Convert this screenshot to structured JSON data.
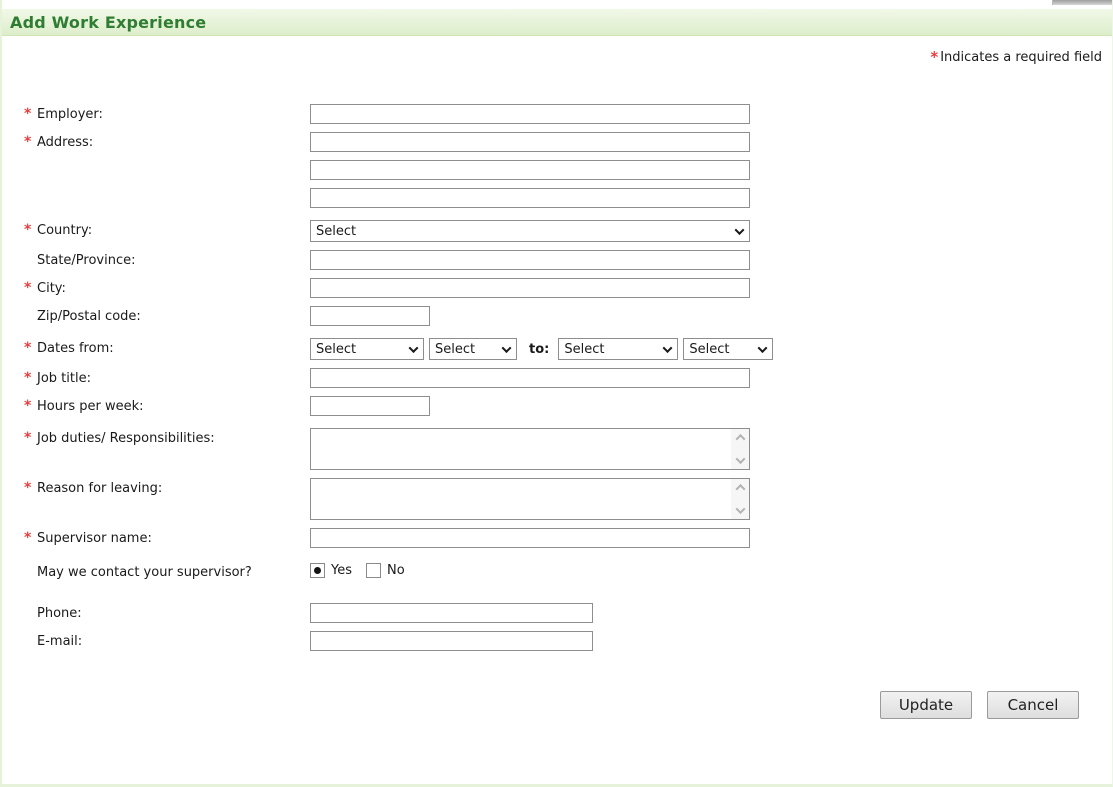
{
  "header": {
    "title": "Add Work Experience"
  },
  "required_marker": "*",
  "required_note": {
    "text": "Indicates a required field"
  },
  "form": {
    "employer": {
      "label": "Employer:",
      "required": true,
      "value": ""
    },
    "address": {
      "label": "Address:",
      "required": true,
      "line1": "",
      "line2": "",
      "line3": ""
    },
    "country": {
      "label": "Country:",
      "required": true,
      "value": "Select"
    },
    "state": {
      "label": "State/Province:",
      "required": false,
      "value": ""
    },
    "city": {
      "label": "City:",
      "required": true,
      "value": ""
    },
    "zip": {
      "label": "Zip/Postal code:",
      "required": false,
      "value": ""
    },
    "dates": {
      "label": "Dates from:",
      "required": true,
      "from_month": "Select",
      "from_year": "Select",
      "to_label": "to:",
      "to_month": "Select",
      "to_year": "Select"
    },
    "job_title": {
      "label": "Job title:",
      "required": true,
      "value": ""
    },
    "hours": {
      "label": "Hours per week:",
      "required": true,
      "value": ""
    },
    "duties": {
      "label": "Job duties/ Responsibilities:",
      "required": true,
      "value": ""
    },
    "reason": {
      "label": "Reason for leaving:",
      "required": true,
      "value": ""
    },
    "supervisor": {
      "label": "Supervisor name:",
      "required": true,
      "value": ""
    },
    "contact": {
      "label": "May we contact your supervisor?",
      "yes": "Yes",
      "no": "No",
      "selected": "Yes"
    },
    "phone": {
      "label": "Phone:",
      "required": false,
      "value": ""
    },
    "email": {
      "label": "E-mail:",
      "required": false,
      "value": ""
    }
  },
  "buttons": {
    "update": "Update",
    "cancel": "Cancel"
  },
  "colors": {
    "header_text": "#2e7d32",
    "header_bg_top": "#f1f8e8",
    "header_bg_bottom": "#ddeecb",
    "panel_border": "#e6f2da",
    "required_red": "#e5403f",
    "input_border": "#8e8e8e"
  }
}
